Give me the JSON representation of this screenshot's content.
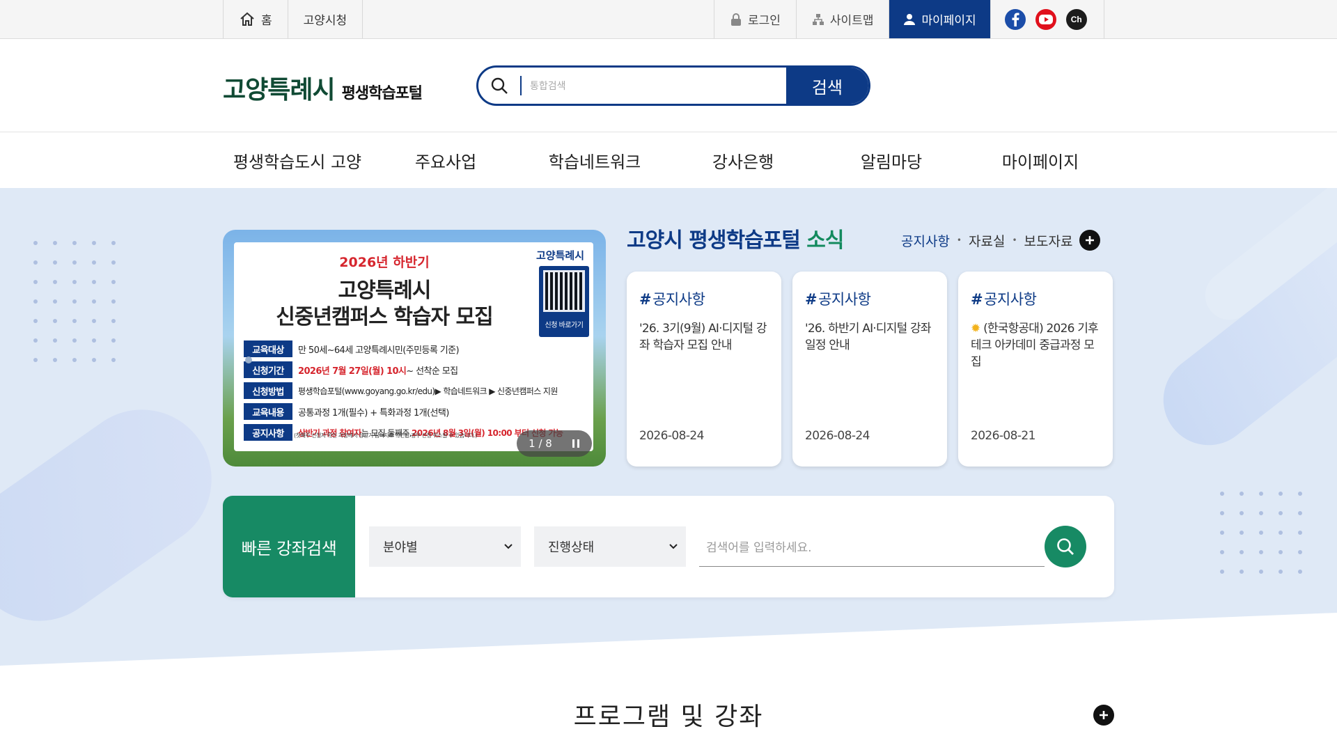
{
  "topbar": {
    "home": "홈",
    "city_hall": "고양시청",
    "login": "로그인",
    "sitemap": "사이트맵",
    "mypage": "마이페이지",
    "channel_label": "Ch"
  },
  "header": {
    "logo_city": "고양특례시",
    "logo_portal": "평생학습포털",
    "search_placeholder": "통합검색",
    "search_button": "검색"
  },
  "gnb": {
    "items": [
      "평생학습도시 고양",
      "주요사업",
      "학습네트워크",
      "강사은행",
      "알림마당",
      "마이페이지"
    ]
  },
  "banner": {
    "subtitle": "2026년 하반기",
    "title_line1": "고양특례시",
    "title_line2": "신중년캠퍼스 학습자 모집",
    "brand": "고양특례시",
    "qr_label": "신청 바로가기",
    "rows": [
      {
        "tag": "교육대상",
        "text": "만 50세~64세 고양특례시민(주민등록 기준)"
      },
      {
        "tag": "신청기간",
        "red": "2026년 7월 27일(월) 10시",
        "text": " ~ 선착순 모집"
      },
      {
        "tag": "신청방법",
        "text": "평생학습포털(www.goyang.go.kr/edu)▶ 학습네트워크 ▶ 신중년캠퍼스 지원"
      },
      {
        "tag": "교육내용",
        "text": "공통과정 1개(필수) + 특화과정 1개(선택)"
      },
      {
        "tag": "공지사항",
        "red": "상반기 과정 참여자",
        "text": "는 모집 둘째주, ",
        "red2": "2026년 8월 3일(월) 10:00 부터 신청 가능"
      }
    ],
    "note": "(첫째주 신청자 확인 과정에서 상반기 참여자로 확인될 경우 신청 취소될 수 있습니다.)",
    "pager": "1 / 8"
  },
  "news": {
    "title_main": "고양시 평생학습포털 ",
    "title_accent": "소식",
    "tabs": [
      "공지사항",
      "자료실",
      "보도자료"
    ],
    "cards": [
      {
        "category": "공지사항",
        "title": "'26. 3기(9월) AI·디지털 강좌 학습자 모집 안내",
        "date": "2026-08-24"
      },
      {
        "category": "공지사항",
        "title": "'26. 하반기 AI·디지털 강좌 일정 안내",
        "date": "2026-08-24"
      },
      {
        "category": "공지사항",
        "title": "(한국항공대) 2026 기후테크 아카데미 중급과정 모집",
        "date": "2026-08-21"
      }
    ]
  },
  "quick_search": {
    "label": "빠른 강좌검색",
    "field_select": "분야별",
    "status_select": "진행상태",
    "keyword_placeholder": "검색어를 입력하세요."
  },
  "program": {
    "title": "프로그램 및 강좌"
  },
  "colors": {
    "primary_navy": "#0d3a86",
    "brand_green": "#104a34",
    "accent_green": "#178a64",
    "notice_red": "#d6262e",
    "visual_bg": "#dfe9f6"
  },
  "icons": [
    "home-icon",
    "lock-icon",
    "sitemap-icon",
    "user-icon",
    "facebook-icon",
    "youtube-icon",
    "kakao-channel-icon",
    "search-icon",
    "plus-icon",
    "chevron-down-icon",
    "pause-icon",
    "sun-icon"
  ]
}
